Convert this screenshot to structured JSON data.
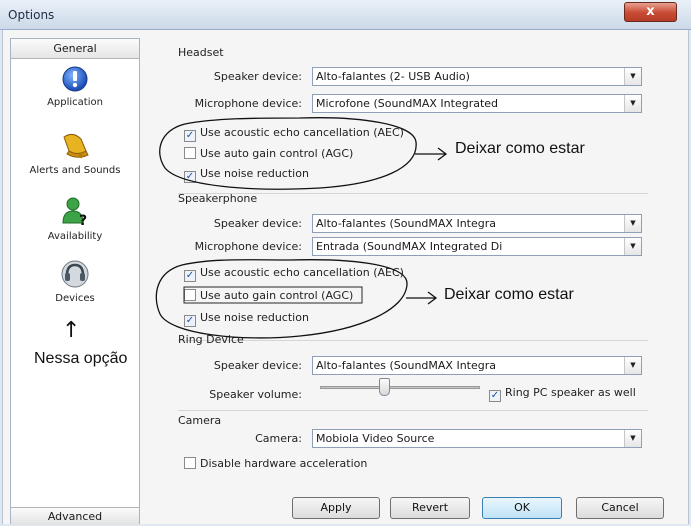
{
  "window": {
    "title": "Options",
    "close_glyph": "x"
  },
  "sidebar": {
    "header": "General",
    "items": [
      {
        "label": "Application",
        "icon": "info-icon"
      },
      {
        "label": "Alerts and Sounds",
        "icon": "bell-icon"
      },
      {
        "label": "Availability",
        "icon": "user-status-icon"
      },
      {
        "label": "Devices",
        "icon": "headset-icon"
      }
    ],
    "footer": "Advanced"
  },
  "annotations": {
    "arrow_up": "↑",
    "nessa": "Nessa opção",
    "deixar_1": "Deixar como estar",
    "deixar_2": "Deixar como estar"
  },
  "headset": {
    "group": "Headset",
    "speaker_label": "Speaker device:",
    "speaker_value": "Alto-falantes (2- USB Audio)",
    "mic_label": "Microphone device:",
    "mic_value": "Microfone (SoundMAX Integrated",
    "aec": {
      "label": "Use acoustic echo cancellation (AEC)",
      "checked": true
    },
    "agc": {
      "label": "Use auto gain control (AGC)",
      "checked": false
    },
    "noise": {
      "label": "Use noise reduction",
      "checked": true
    }
  },
  "speakerphone": {
    "group": "Speakerphone",
    "speaker_label": "Speaker device:",
    "speaker_value": "Alto-falantes (SoundMAX Integra",
    "mic_label": "Microphone device:",
    "mic_value": "Entrada (SoundMAX Integrated Di",
    "aec": {
      "label": "Use acoustic echo cancellation (AEC)",
      "checked": true
    },
    "agc": {
      "label": "Use auto gain control (AGC)",
      "checked": false
    },
    "noise": {
      "label": "Use noise reduction",
      "checked": true
    }
  },
  "ring": {
    "group": "Ring Device",
    "speaker_label": "Speaker device:",
    "speaker_value": "Alto-falantes (SoundMAX Integra",
    "volume_label": "Speaker volume:",
    "volume_level": 0.4,
    "ring_pc": {
      "label": "Ring PC speaker as well",
      "checked": true
    }
  },
  "camera": {
    "group": "Camera",
    "camera_label": "Camera:",
    "camera_value": "Mobiola Video Source",
    "disable_hw": {
      "label": "Disable hardware acceleration",
      "checked": false
    }
  },
  "buttons": {
    "apply": "Apply",
    "revert": "Revert",
    "ok": "OK",
    "cancel": "Cancel"
  },
  "colors": {
    "accent": "#3c7fb1",
    "close": "#c84a33"
  }
}
